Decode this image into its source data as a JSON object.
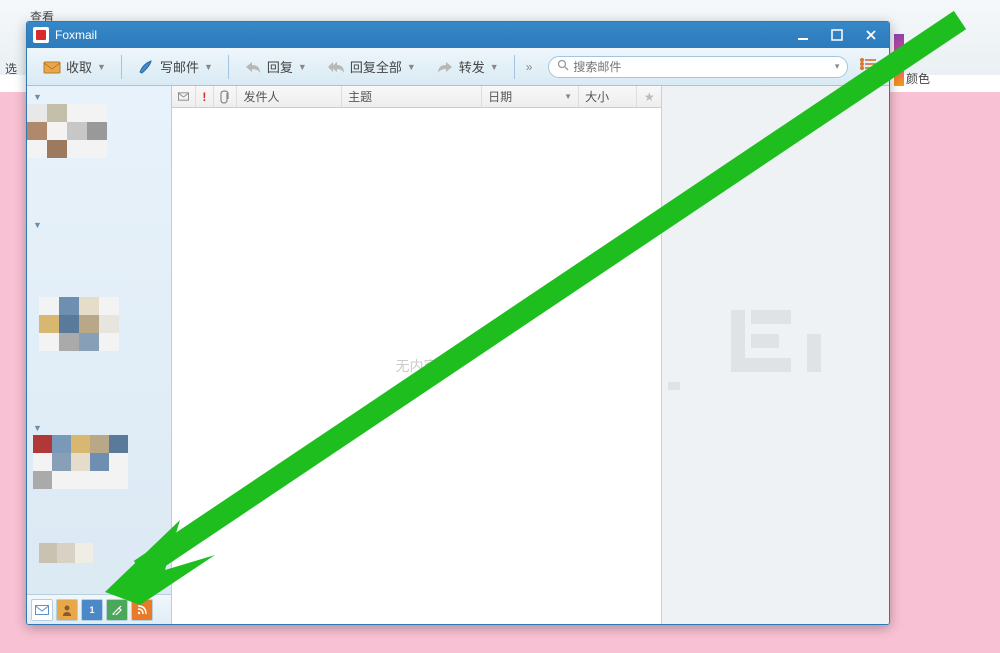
{
  "bg": {
    "view": "查看",
    "select": "选",
    "color": "颜色"
  },
  "app": {
    "title": "Foxmail"
  },
  "toolbar": {
    "receive": "收取",
    "compose": "写邮件",
    "reply": "回复",
    "reply_all": "回复全部",
    "forward": "转发",
    "search_placeholder": "搜索邮件"
  },
  "columns": {
    "sender": "发件人",
    "subject": "主题",
    "date": "日期",
    "size": "大小"
  },
  "empty_text": "无内容",
  "colors": {
    "acc1": [
      "#e8e8e8",
      "#c4bfa8",
      "#f3f3f3",
      "#f3f3f3",
      "#b0886b",
      "#f3f3f3",
      "#c7c7c7",
      "#999",
      "#f3f3f3",
      "#9c7a60",
      "#f3f3f3",
      "#f3f3f3"
    ],
    "acc2": [
      "#f3f3f3",
      "#6e8fb0",
      "#e5dcc9",
      "#f3f3f3",
      "#d8b870",
      "#5a7a9c",
      "#b8a888",
      "#e8e5de",
      "#f3f3f3",
      "#aaa",
      "#87a0b8",
      "#f3f3f3"
    ],
    "acc3": [
      "#b03838",
      "#7a98b8",
      "#d8b870",
      "#b8a888",
      "#5a7a9c",
      "#f3f3f3",
      "#87a0b8",
      "#e5dcc9",
      "#6e8fb0",
      "#f3f3f3",
      "#aaa",
      "#f3f3f3",
      "#f3f3f3",
      "#f3f3f3",
      "#f3f3f3"
    ],
    "acc4": [
      "#c9c2b0",
      "#d8d2c5",
      "#f0ede5"
    ]
  }
}
